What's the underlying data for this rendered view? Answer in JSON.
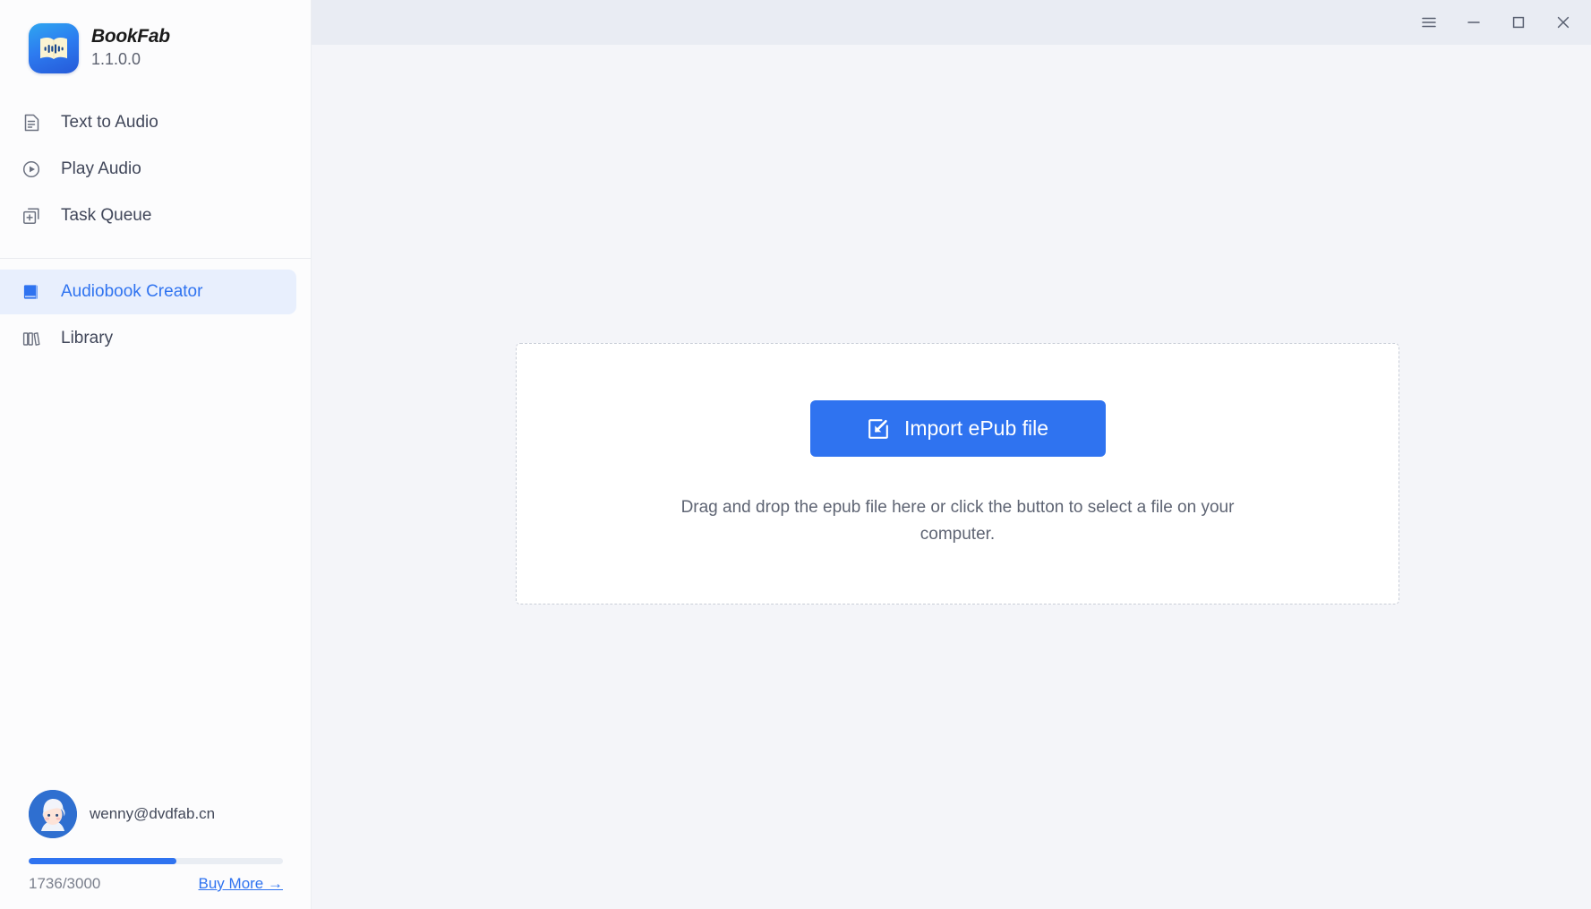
{
  "brand": {
    "name": "BookFab",
    "version": "1.1.0.0",
    "logo_icon": "open-book-waveform-icon"
  },
  "titlebar": {
    "menu_icon": "hamburger-menu-icon",
    "minimize_icon": "minimize-icon",
    "maximize_icon": "maximize-icon",
    "close_icon": "close-icon"
  },
  "sidebar": {
    "primary_items": [
      {
        "label": "Text to Audio",
        "icon": "document-text-icon",
        "active": false
      },
      {
        "label": "Play Audio",
        "icon": "play-circle-icon",
        "active": false
      },
      {
        "label": "Task Queue",
        "icon": "add-to-queue-icon",
        "active": false
      }
    ],
    "secondary_items": [
      {
        "label": "Audiobook Creator",
        "icon": "book-icon",
        "active": true
      },
      {
        "label": "Library",
        "icon": "bookshelf-icon",
        "active": false
      }
    ]
  },
  "account": {
    "avatar_icon": "user-avatar",
    "email": "wenny@dvdfab.cn",
    "quota_text": "1736/3000",
    "quota_used": 1736,
    "quota_total": 3000,
    "quota_percent": 58,
    "buy_more_label": "Buy More →"
  },
  "main": {
    "dropzone": {
      "import_button_label": "Import ePub file",
      "import_button_icon": "import-file-icon",
      "hint_text": "Drag and drop the epub file here or click the button to select a file on your computer."
    }
  },
  "colors": {
    "accent": "#2f73f0",
    "titlebar_bg": "#e9ecf3",
    "content_bg": "#f4f5f9",
    "sidebar_bg": "#fcfcfd",
    "active_item_bg": "#e8effd"
  }
}
